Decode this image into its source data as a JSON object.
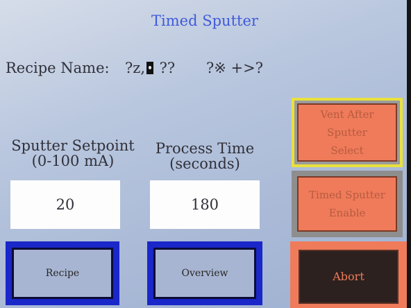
{
  "screen": {
    "title": "Timed Sputter",
    "recipe": {
      "label": "Recipe Name:",
      "value_before_cursor": "?z,",
      "value_after_cursor": " ??",
      "value_tail": "?&#8251; +>?"
    },
    "sputter_setpoint": {
      "label_line1": "Sputter Setpoint",
      "label_line2": "(0-100 mA)",
      "value": "20"
    },
    "process_time": {
      "label_line1": "Process Time",
      "label_line2": "(seconds)",
      "value": "180"
    },
    "buttons": {
      "recipe": "Recipe",
      "overview": "Overview",
      "vent_line1": "Vent After",
      "vent_line2": "Sputter",
      "vent_line3": "Select",
      "timed_line1": "Timed Sputter",
      "timed_line2": "Enable",
      "abort": "Abort"
    }
  },
  "colors": {
    "title": "#3f5bd9",
    "button_orange": "#ef7b5a",
    "button_blue": "#1a27c9",
    "highlight_yellow": "#e9e13c"
  }
}
